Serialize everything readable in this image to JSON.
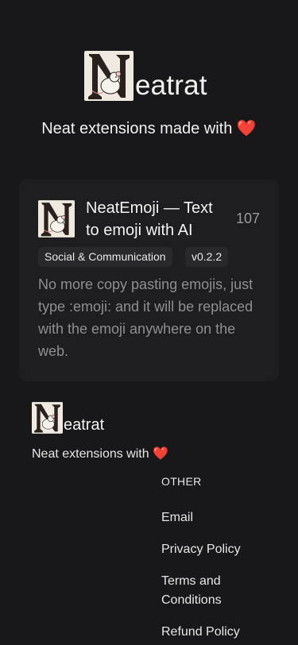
{
  "hero": {
    "brand_text": "eatrat",
    "tagline": "Neat extensions made with",
    "heart_glyph": "❤️"
  },
  "card": {
    "title": "NeatEmoji — Text to emoji with AI",
    "count": "107",
    "category_tag": "Social & Communication",
    "version_tag": "v0.2.2",
    "description": "No more copy pasting emojis, just type :emoji: and it will be replaced with the emoji anywhere on the web."
  },
  "footer": {
    "brand_text": "eatrat",
    "tagline": "Neat extensions with",
    "heart_glyph": "❤️",
    "section_heading": "OTHER",
    "links": [
      {
        "label": "Email"
      },
      {
        "label": "Privacy Policy"
      },
      {
        "label": "Terms and Conditions"
      },
      {
        "label": "Refund Policy"
      }
    ]
  },
  "colors": {
    "background": "#18181a",
    "card_background": "#1e1e20",
    "tag_background": "#29292c",
    "muted_text": "#8e8e93",
    "heart": "#e0322f"
  },
  "icons": {
    "logo": "neatrat-logo-icon",
    "heart": "heart-icon"
  }
}
